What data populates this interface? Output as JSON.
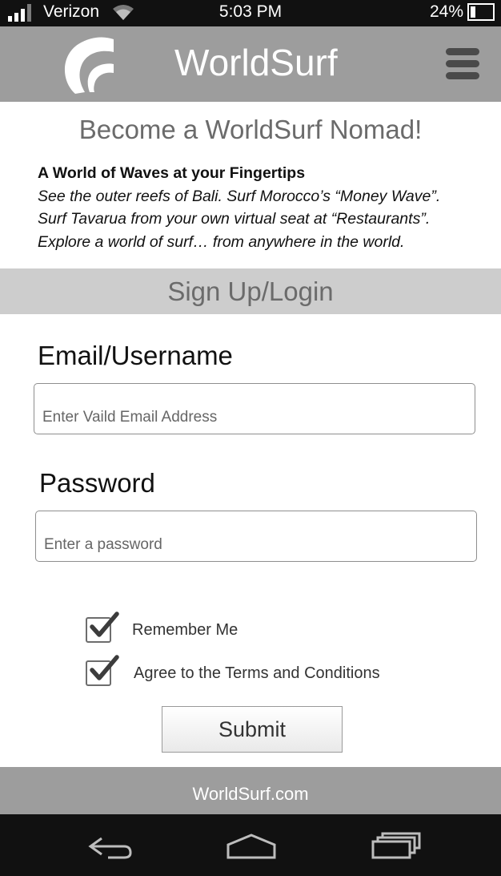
{
  "status_bar": {
    "carrier": "Verizon",
    "time": "5:03 PM",
    "battery": "24%",
    "battery_level": 0.24
  },
  "header": {
    "app_name": "WorldSurf"
  },
  "intro": {
    "headline": "Become a WorldSurf Nomad!",
    "subheading": "A World of Waves at your Fingertips",
    "lines": [
      "See the outer reefs of Bali. Surf Morocco’s “Money Wave”.",
      "Surf Tavarua from your own virtual seat at “Restaurants”.",
      "Explore a world of surf… from anywhere in the world."
    ]
  },
  "section": {
    "title": "Sign Up/Login"
  },
  "form": {
    "email_label": "Email/Username",
    "email_placeholder": "Enter Vaild Email Address",
    "password_label": "Password",
    "password_placeholder": "Enter a password",
    "remember_label": "Remember Me",
    "remember_checked": true,
    "terms_label": "Agree to the Terms and Conditions",
    "terms_checked": true,
    "submit_label": "Submit"
  },
  "footer": {
    "text": "WorldSurf.com"
  },
  "icons": {
    "signal": "signal-bars-icon",
    "wifi": "wifi-icon",
    "battery": "battery-icon",
    "logo": "worldsurf-wave-logo",
    "menu": "hamburger-menu-icon",
    "checkbox": "checkmark-icon",
    "back": "back-arrow-icon",
    "home": "home-icon",
    "recents": "recent-apps-icon"
  },
  "colors": {
    "header_gray": "#9d9d9d",
    "band_gray": "#cdcdcd",
    "status_bar": "#111111",
    "headline_text": "#6b6b6b"
  }
}
